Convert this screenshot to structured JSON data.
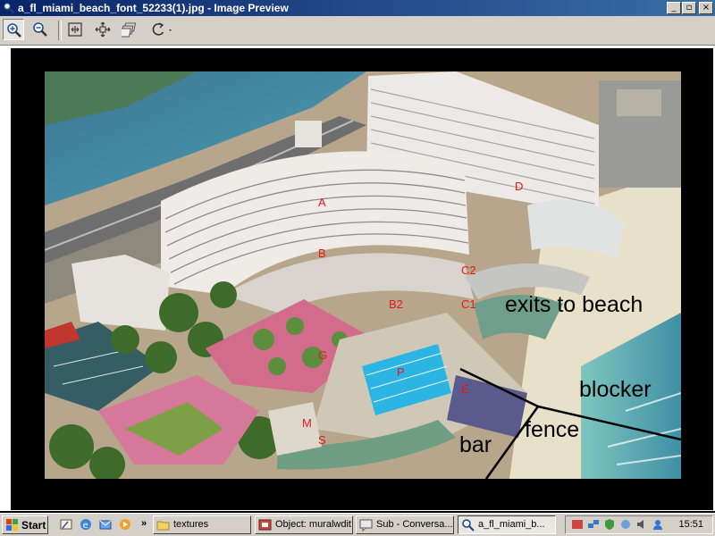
{
  "window": {
    "title": "a_fl_miami_beach_font_52233(1).jpg - Image Preview",
    "controls": {
      "minimize": "_",
      "maximize": "▫",
      "close": "×"
    }
  },
  "toolbar": {
    "buttons": [
      "zoom-in-icon",
      "zoom-out-icon",
      "best-fit-icon",
      "actual-size-icon",
      "slideshow-icon",
      "rotate-icon"
    ]
  },
  "photo": {
    "labels": {
      "A": "A",
      "B": "B",
      "B2": "B2",
      "C1": "C1",
      "C2": "C2",
      "D": "D",
      "E": "E",
      "G": "G",
      "P": "P",
      "M": "M",
      "S": "S",
      "exits": "exits to beach",
      "blocker": "blocker",
      "fence": "fence",
      "bar": "bar"
    },
    "colors": {
      "label_red": "#e31a1a",
      "ocean": "#3d7d9a",
      "pool": "#2bb2e0",
      "garden": "#d47391"
    }
  },
  "taskbar": {
    "start": "Start",
    "quick_launch": [
      "show-desktop-icon",
      "ie-icon",
      "outlook-icon",
      "media-player-icon"
    ],
    "chevron": "»",
    "tasks": [
      {
        "label": "textures",
        "icon": "folder-icon"
      },
      {
        "label": "Object: muralwdit",
        "icon": "app-icon"
      },
      {
        "label": "Sub - Conversa...",
        "icon": "chat-icon"
      },
      {
        "label": "a_fl_miami_b...",
        "icon": "image-preview-icon"
      }
    ],
    "clock": "15:51"
  }
}
